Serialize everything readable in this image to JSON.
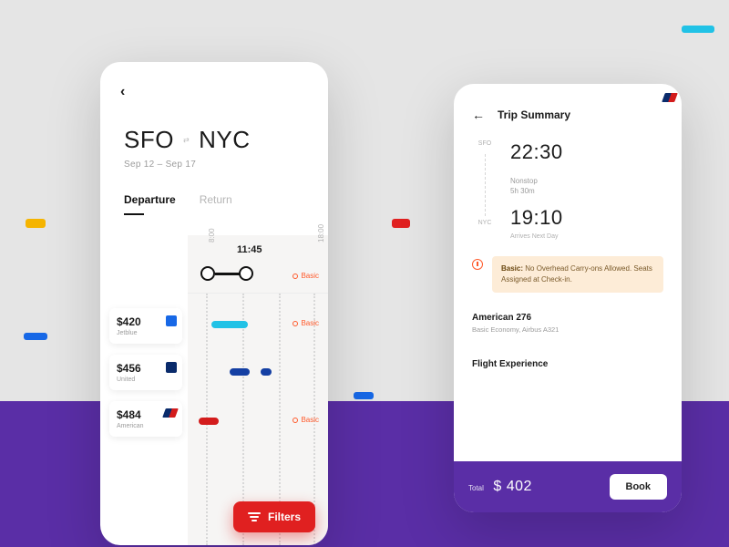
{
  "search": {
    "origin": "SFO",
    "destination": "NYC",
    "date_out": "Sep 12",
    "date_back": "Sep 17",
    "date_sep": "–",
    "tabs": {
      "departure": "Departure",
      "return": "Return"
    },
    "timeline": {
      "start_label": "8:00",
      "end_label": "18:00",
      "selected_time": "11:45",
      "fare_badge": "Basic"
    },
    "results": [
      {
        "price": "$420",
        "airline": "Jetblue"
      },
      {
        "price": "$456",
        "airline": "United"
      },
      {
        "price": "$484",
        "airline": "American"
      }
    ],
    "filters_label": "Filters"
  },
  "summary": {
    "title": "Trip Summary",
    "origin_code": "SFO",
    "dest_code": "NYC",
    "dep_time": "22:30",
    "stops": "Nonstop",
    "duration": "5h 30m",
    "arr_time": "19:10",
    "arrive_note": "Arrives Next Day",
    "warning_label": "Basic:",
    "warning_text": " No Overhead Carry-ons Allowed. Seats Assigned at Check-in.",
    "carrier_name": "American 276",
    "carrier_sub": "Basic Economy, Airbus A321",
    "experience_heading": "Flight Experience",
    "total_label": "Total",
    "total_value": "$ 402",
    "book_label": "Book"
  }
}
